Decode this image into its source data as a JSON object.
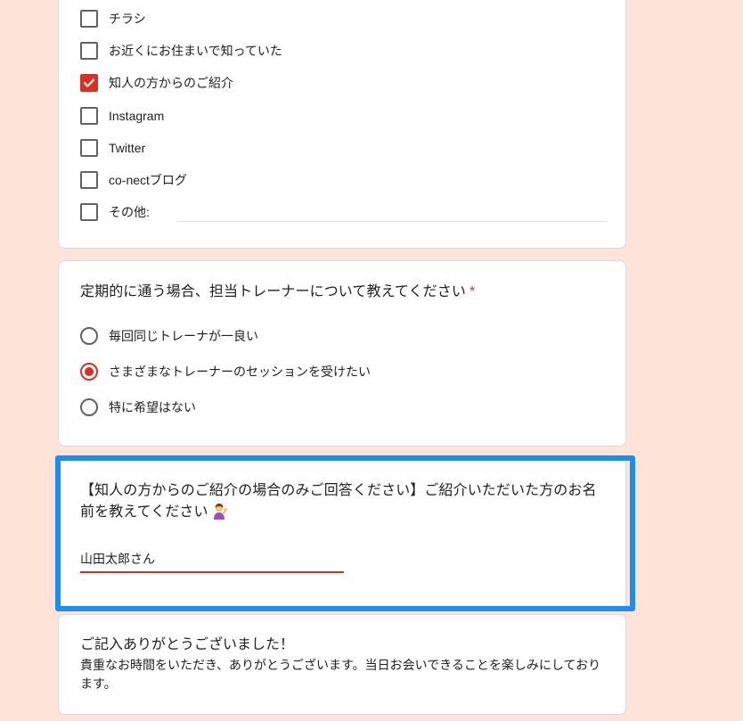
{
  "sources_question": {
    "options": [
      {
        "label": "チラシ",
        "checked": false
      },
      {
        "label": "お近くにお住まいで知っていた",
        "checked": false
      },
      {
        "label": "知人の方からのご紹介",
        "checked": true
      },
      {
        "label": "Instagram",
        "checked": false
      },
      {
        "label": "Twitter",
        "checked": false
      },
      {
        "label": "co-nectブログ",
        "checked": false
      },
      {
        "label": "その他:",
        "checked": false
      }
    ]
  },
  "trainer_question": {
    "title": "定期的に通う場合、担当トレーナーについて教えてください",
    "required_mark": "*",
    "options": [
      {
        "label": "毎回同じトレーナが一良い",
        "selected": false
      },
      {
        "label": "さまざまなトレーナーのセッションを受けたい",
        "selected": true
      },
      {
        "label": "特に希望はない",
        "selected": false
      }
    ]
  },
  "referral_question": {
    "title_line1": "【知人の方からのご紹介の場合のみご回答ください】ご紹介いただいた方のお名",
    "title_line2": "前を教えてください",
    "emoji_icon": "person-raising-hand-emoji",
    "answer_value": "山田太郎さん"
  },
  "thanks": {
    "title": "ご記入ありがとうございました！",
    "body": "貴重なお時間をいただき、ありがとうございます。当日お会いできることを楽しみにしております。"
  },
  "colors": {
    "page_background": "#fde3d8",
    "accent": "#d93025",
    "highlight": "#1a8ff0"
  }
}
